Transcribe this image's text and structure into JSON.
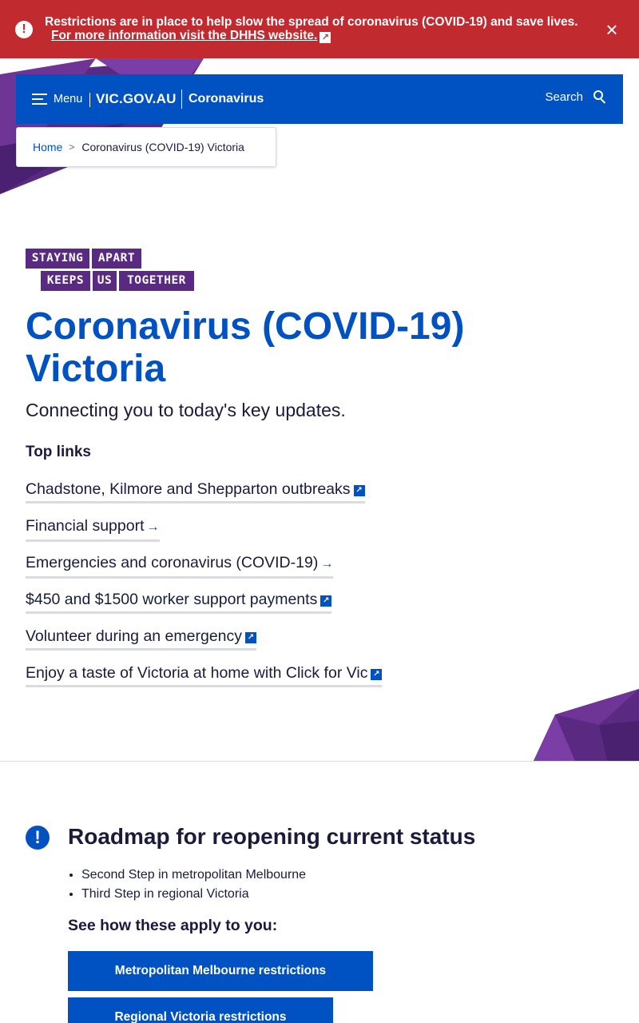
{
  "alert": {
    "text": "Restrictions are in place to help slow the spread of coronavirus (COVID-19) and save lives.",
    "link_text": "For more information visit the DHHS website.",
    "icon": "alert-exclamation-icon",
    "close_icon": "close-icon"
  },
  "header": {
    "menu_label": "Menu",
    "brand": "VIC.GOV.AU",
    "site_name": "Coronavirus",
    "search_label": "Search"
  },
  "breadcrumb": {
    "home": "Home",
    "separator": ">",
    "current": "Coronavirus (COVID-19) Victoria"
  },
  "campaign_logo": {
    "words": [
      "STAYING",
      "APART",
      "KEEPS",
      "US",
      "TOGETHER"
    ]
  },
  "hero": {
    "title": "Coronavirus (COVID-19) Victoria",
    "intro": "Connecting you to today's key updates.",
    "top_links_heading": "Top links",
    "links": [
      {
        "label": "Chadstone, Kilmore and Shepparton outbreaks",
        "icon": "external-link-icon"
      },
      {
        "label": "Financial support",
        "icon": "arrow-right-icon"
      },
      {
        "label": "Emergencies and coronavirus (COVID-19)",
        "icon": "arrow-right-icon"
      },
      {
        "label": "$450 and $1500 worker support payments",
        "icon": "external-link-icon"
      },
      {
        "label": "Volunteer during an emergency",
        "icon": "external-link-icon"
      },
      {
        "label": "Enjoy a taste of Victoria at home with Click for Vic",
        "icon": "external-link-icon"
      }
    ]
  },
  "roadmap": {
    "title": "Roadmap for reopening current status",
    "icon": "alert-exclamation-icon",
    "items": [
      "Second Step in metropolitan Melbourne",
      "Third Step in regional Victoria"
    ],
    "subheading": "See how these apply to you:",
    "buttons": [
      "Metropolitan Melbourne restrictions",
      "Regional Victoria restrictions"
    ]
  },
  "colors": {
    "alert_red": "#c12a2e",
    "brand_blue": "#0052c2",
    "purple": "#5a2a82",
    "text_dark": "#1a1a3d"
  }
}
